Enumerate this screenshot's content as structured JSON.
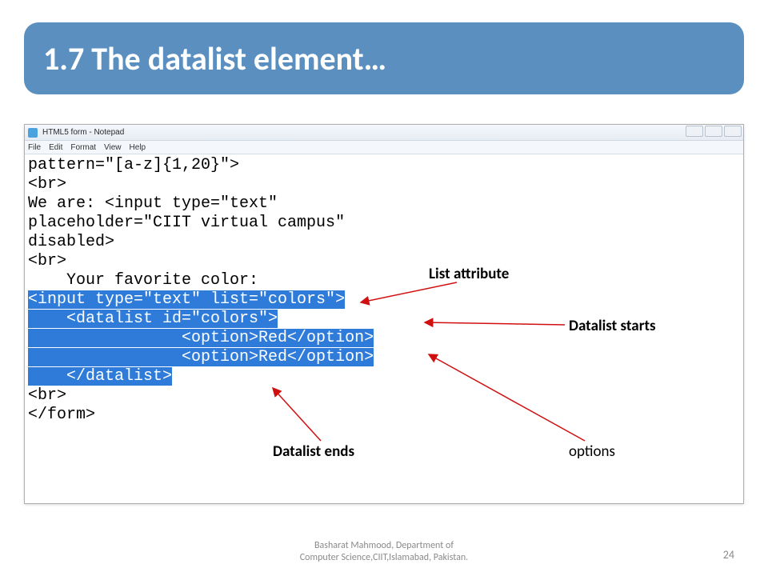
{
  "title": "1.7 The datalist element…",
  "notepad": {
    "window_title": "HTML5 form - Notepad",
    "menu": {
      "file": "File",
      "edit": "Edit",
      "format": "Format",
      "view": "View",
      "help": "Help"
    },
    "code": {
      "l1": "pattern=\"[a-z]{1,20}\">",
      "l2": "<br>",
      "l3": "We are: <input type=\"text\"",
      "l4": "placeholder=\"CIIT virtual campus\"",
      "l5": "disabled>",
      "l6": "<br>",
      "l7": "    Your favorite color:",
      "l8": "<input type=\"text\" list=\"colors\">",
      "l9": "    <datalist id=\"colors\">",
      "l10": "                <option>Red</option>",
      "l11": "                <option>Red</option>",
      "l12": "    </datalist>",
      "l13": "",
      "l14": "<br>",
      "l15": "</form>"
    }
  },
  "annotations": {
    "list_attribute": "List attribute",
    "datalist_starts": "Datalist starts",
    "datalist_ends": "Datalist ends",
    "options": "options"
  },
  "footer": {
    "line1": "Basharat Mahmood, Department of",
    "line2": "Computer Science,CIIT,Islamabad, Pakistan.",
    "page": "24"
  }
}
